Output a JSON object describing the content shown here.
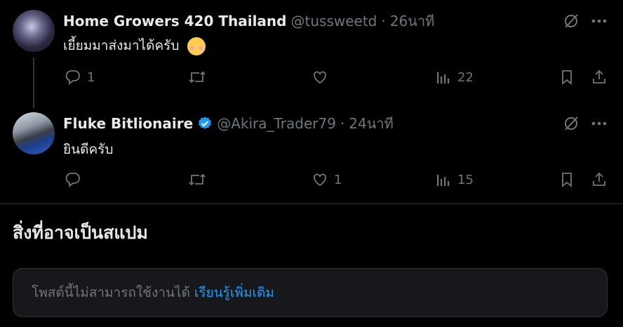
{
  "tweets": [
    {
      "name": "Home Growers 420 Thailand",
      "handle": "@tussweetd",
      "time": "26นาที",
      "sep": "·",
      "text": "เยี้ยมมาส่งมาได้ครับ",
      "verified": false,
      "stats": {
        "replies": "1",
        "retweets": "",
        "likes": "",
        "views": "22"
      }
    },
    {
      "name": "Fluke Bitlionaire",
      "handle": "@Akira_Trader79",
      "time": "24นาที",
      "sep": "·",
      "text": "ยินดีครับ",
      "verified": true,
      "stats": {
        "replies": "",
        "retweets": "",
        "likes": "1",
        "views": "15"
      }
    }
  ],
  "spam_section": {
    "title": "สิ่งที่อาจเป็นสแปม",
    "notice_text": "โพสต์นี้ไม่สามารถใช้งานได้",
    "learn_more": "เรียนรู้เพิ่มเติม"
  },
  "colors": {
    "background": "#000000",
    "text": "#e7e9ea",
    "muted": "#71767b",
    "accent": "#1d9bf0"
  }
}
